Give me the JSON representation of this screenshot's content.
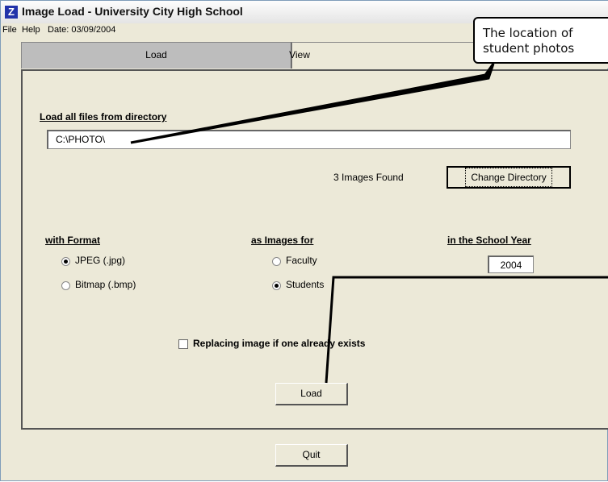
{
  "window": {
    "icon": "Z",
    "title": "Image Load - University City High School"
  },
  "menu": {
    "file": "File",
    "help": "Help",
    "date": "Date: 03/09/2004"
  },
  "tabs": [
    {
      "label": "Load",
      "accesskey": "L"
    },
    {
      "label": "View",
      "accesskey": "V"
    }
  ],
  "load": {
    "directory_label": "Load all files from directory",
    "directory_value": "C:\\PHOTO\\",
    "images_found": "3 Images Found",
    "change_directory_button": "Change Directory",
    "format_label": "with Format",
    "format_options": [
      "JPEG (.jpg)",
      "Bitmap (.bmp)"
    ],
    "format_selected": "JPEG (.jpg)",
    "images_for_label": "as Images for",
    "images_for_options": [
      "Faculty",
      "Students"
    ],
    "images_for_selected": "Students",
    "school_year_label": "in the School Year",
    "school_year_value": "2004",
    "replace_checkbox_label": "Replacing image if one already exists",
    "replace_checked": false,
    "load_button": "Load"
  },
  "quit_button": "Quit",
  "callout": {
    "line1": "The location of",
    "line2": "student photos"
  },
  "colors": {
    "window_bg": "#ece9d8",
    "active_tab_bg": "#bdbdbd",
    "title_icon_bg": "#2233aa",
    "callout_bg": "#ffffff"
  }
}
